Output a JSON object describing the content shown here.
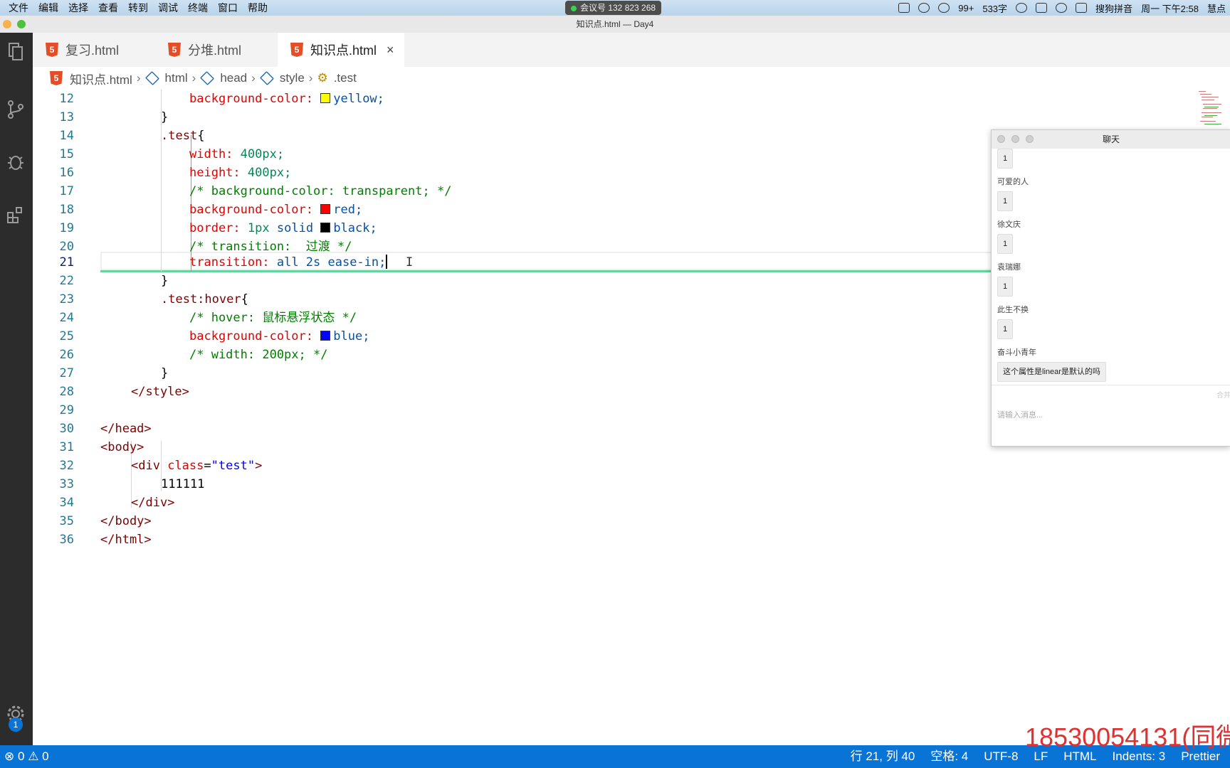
{
  "menubar": {
    "items": [
      "文件",
      "编辑",
      "选择",
      "查看",
      "转到",
      "调试",
      "终端",
      "窗口",
      "帮助"
    ],
    "meeting": "会议号 132 823 268",
    "tray": {
      "wechat_badge": "99+",
      "word_count": "533字",
      "input_method": "搜狗拼音",
      "clock": "周一 下午2:58",
      "user": "慧点"
    }
  },
  "window": {
    "title": "知识点.html — Day4"
  },
  "tabs": [
    {
      "label": "复习.html"
    },
    {
      "label": "分堆.html"
    },
    {
      "label": "知识点.html",
      "close": "×"
    }
  ],
  "breadcrumbs": {
    "file": "知识点.html",
    "html": "html",
    "head": "head",
    "style": "style",
    "selector": ".test"
  },
  "editor": {
    "lines": [
      {
        "n": "12"
      },
      {
        "n": "13"
      },
      {
        "n": "14"
      },
      {
        "n": "15"
      },
      {
        "n": "16"
      },
      {
        "n": "17"
      },
      {
        "n": "18"
      },
      {
        "n": "19"
      },
      {
        "n": "20"
      },
      {
        "n": "21"
      },
      {
        "n": "22"
      },
      {
        "n": "23"
      },
      {
        "n": "24"
      },
      {
        "n": "25"
      },
      {
        "n": "26"
      },
      {
        "n": "27"
      },
      {
        "n": "28"
      },
      {
        "n": "29"
      },
      {
        "n": "30"
      },
      {
        "n": "31"
      },
      {
        "n": "32"
      },
      {
        "n": "33"
      },
      {
        "n": "34"
      },
      {
        "n": "35"
      },
      {
        "n": "36"
      }
    ],
    "code": {
      "l12_prop": "background-color:",
      "l12_val": "yellow;",
      "l13": "}",
      "l14_sel": ".test",
      "l14_brace": "{",
      "l15_prop": "width:",
      "l15_val": "400px;",
      "l16_prop": "height:",
      "l16_val": "400px;",
      "l17": "/* background-color: transparent; */",
      "l18_prop": "background-color:",
      "l18_val": "red;",
      "l19_prop": "border:",
      "l19_num": "1px",
      "l19_rest": "solid",
      "l19_val": "black;",
      "l20": "/* transition:  过渡 */",
      "l21_prop": "transition:",
      "l21_val": "all 2s ease-in;",
      "l22": "}",
      "l23_sel": ".test:hover",
      "l23_brace": "{",
      "l24": "/* hover: 鼠标悬浮状态 */",
      "l25_prop": "background-color:",
      "l25_val": "blue;",
      "l26": "/* width: 200px; */",
      "l27": "}",
      "l28": "</style>",
      "l30": "</head>",
      "l31": "<body>",
      "l32_open": "<div",
      "l32_attr": "class",
      "l32_eq": "=",
      "l32_str": "\"test\"",
      "l32_close": ">",
      "l33": "111111",
      "l34": "</div>",
      "l35": "</body>",
      "l36": "</html>"
    },
    "swatches": {
      "yellow": "#ffff00",
      "red": "#ff0000",
      "black": "#000000",
      "blue": "#0000ff"
    }
  },
  "chat": {
    "title": "聊天",
    "messages": [
      {
        "name": "",
        "text": "1"
      },
      {
        "name": "可爱的人",
        "text": "1"
      },
      {
        "name": "徐文庆",
        "text": "1"
      },
      {
        "name": "袁瑞娜",
        "text": "1"
      },
      {
        "name": "此生不换",
        "text": "1"
      },
      {
        "name": "奋斗小青年",
        "text": "这个属性是linear是默认的吗"
      }
    ],
    "input_placeholder": "请输入消息...",
    "merge_hint": "合并"
  },
  "status": {
    "errors": "0",
    "warnings": "0",
    "position": "行 21, 列 40",
    "spaces": "空格: 4",
    "encoding": "UTF-8",
    "eol": "LF",
    "language": "HTML",
    "indents": "Indents: 3",
    "formatter": "Prettier"
  },
  "settings_badge": "1",
  "watermark": "18530054131(同微"
}
